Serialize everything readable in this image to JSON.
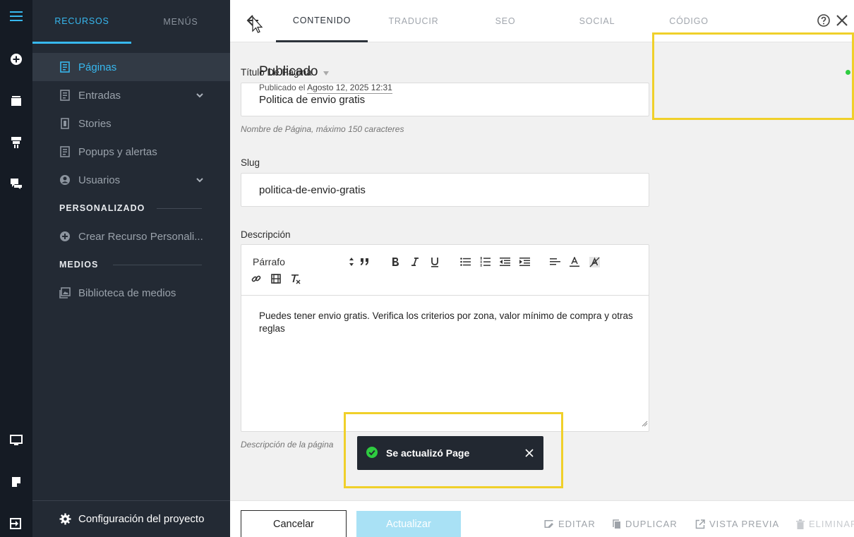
{
  "colors": {
    "accent": "#37b8ef",
    "highlight": "#f0d02a",
    "rail": "#151b24",
    "sidebar": "#232a34",
    "success": "#2ecc40"
  },
  "rail": {
    "icons": [
      "menu-icon",
      "add-icon",
      "layers-icon",
      "archive-icon",
      "chat-icon",
      "desktop-icon",
      "notes-icon",
      "exit-icon"
    ]
  },
  "sidebar": {
    "tabs": [
      {
        "label": "RECURSOS"
      },
      {
        "label": "MENÚS"
      }
    ],
    "items": [
      {
        "label": "Páginas",
        "icon": "page-icon"
      },
      {
        "label": "Entradas",
        "icon": "entries-icon"
      },
      {
        "label": "Stories",
        "icon": "stories-icon"
      },
      {
        "label": "Popups y alertas",
        "icon": "popup-icon"
      },
      {
        "label": "Usuarios",
        "icon": "user-icon"
      }
    ],
    "section_custom": "PERSONALIZADO",
    "create_resource": "Crear Recurso Personali...",
    "section_media": "MEDIOS",
    "media_library": "Biblioteca de medios",
    "config": "Configuración del proyecto"
  },
  "topbar": {
    "tabs": [
      {
        "label": "CONTENIDO"
      },
      {
        "label": "TRADUCIR"
      },
      {
        "label": "SEO"
      },
      {
        "label": "SOCIAL"
      },
      {
        "label": "CÓDIGO"
      }
    ]
  },
  "form": {
    "title_label": "Título De Página",
    "title_value": "Politica de envio gratis",
    "title_hint": "Nombre de Página, máximo 150 caracteres",
    "slug_label": "Slug",
    "slug_value": "politica-de-envio-gratis",
    "desc_label": "Descripción",
    "desc_format": "Párrafo",
    "desc_value": "Puedes tener envio gratis. Verifica los criterios por zona, valor mínimo de compra y otras reglas",
    "desc_hint": "Descripción de la página"
  },
  "status": {
    "title": "Publicado",
    "prefix": "Publicado el",
    "date": "Agosto 12, 2025 12:31"
  },
  "toast": {
    "message": "Se actualizó Page"
  },
  "bottombar": {
    "cancel": "Cancelar",
    "update": "Actualizar",
    "edit": "EDITAR",
    "duplicate": "DUPLICAR",
    "preview": "VISTA PREVIA",
    "delete": "ELIMINAR"
  }
}
